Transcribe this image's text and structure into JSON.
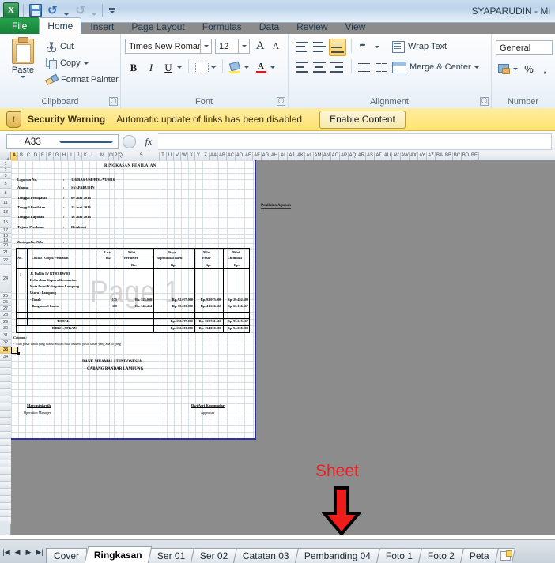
{
  "window": {
    "title": "SYAPARUDIN  -  Mi",
    "logo_text": "X"
  },
  "quick_access": {
    "save_tip": "Save",
    "undo_tip": "Undo",
    "redo_tip": "Redo",
    "customize_tip": "Customize Quick Access Toolbar"
  },
  "ribbon": {
    "tabs": [
      {
        "label": "File",
        "state": "file"
      },
      {
        "label": "Home",
        "state": "active"
      },
      {
        "label": "Insert",
        "state": ""
      },
      {
        "label": "Page Layout",
        "state": ""
      },
      {
        "label": "Formulas",
        "state": ""
      },
      {
        "label": "Data",
        "state": ""
      },
      {
        "label": "Review",
        "state": ""
      },
      {
        "label": "View",
        "state": ""
      }
    ],
    "clipboard": {
      "group_label": "Clipboard",
      "paste_label": "Paste",
      "cut_label": "Cut",
      "copy_label": "Copy",
      "format_painter_label": "Format Painter"
    },
    "font": {
      "group_label": "Font",
      "font_name": "Times New Roman",
      "font_size": "12",
      "bold_label": "B",
      "italic_label": "I",
      "underline_label": "U",
      "font_color_label": "A",
      "grow_label": "A",
      "shrink_label": "A"
    },
    "alignment": {
      "group_label": "Alignment",
      "wrap_text_label": "Wrap Text",
      "merge_center_label": "Merge & Center"
    },
    "number": {
      "group_label": "Number",
      "format": "General",
      "percent_label": "%",
      "comma_label": ","
    }
  },
  "security_bar": {
    "title": "Security Warning",
    "message": "Automatic update of links has been disabled",
    "button_label": "Enable Content"
  },
  "formula_bar": {
    "name_box": "A33",
    "fx_label": "fx",
    "formula": ""
  },
  "grid": {
    "columns": [
      "A",
      "B",
      "C",
      "D",
      "E",
      "F",
      "G",
      "H",
      "I",
      "J",
      "K",
      "L",
      "M",
      "O",
      "P",
      "Q",
      "S",
      "T",
      "U",
      "V",
      "W",
      "X",
      "Y",
      "Z",
      "AA",
      "AB",
      "AC",
      "AD",
      "AE",
      "AF",
      "AG",
      "AH",
      "AI",
      "AJ",
      "AK",
      "AL",
      "AM",
      "AN",
      "AO",
      "AP",
      "AQ",
      "AR",
      "AS",
      "AT",
      "AU",
      "AV",
      "AW",
      "AX",
      "AY",
      "AZ",
      "BA",
      "BB",
      "BC",
      "BD",
      "BE"
    ],
    "selected_column": "A",
    "rows": [
      "1",
      "2",
      "3",
      "5",
      "8",
      "11",
      "13",
      "15",
      "17",
      "18",
      "19",
      "20",
      "21",
      "22",
      "24",
      "25",
      "26",
      "27",
      "28",
      "29",
      "30",
      "31",
      "32",
      "33",
      "34"
    ],
    "selected_row": "33",
    "watermark": "Page 1"
  },
  "document": {
    "title": "RINGKASAN PENILAIAN",
    "side_note": "Penilaian Agunan",
    "fields": [
      {
        "label": "Laporan No.",
        "sep": ":",
        "value": "126/RAS-USP/BDL/VI/2016"
      },
      {
        "label": "Alamat",
        "sep": ":",
        "value": "SYAPARUDIN"
      },
      {
        "label": "Tanggal Penugasan",
        "sep": ":",
        "value": "09 Juni 2016"
      },
      {
        "label": "Tanggal Penilaian",
        "sep": ":",
        "value": "15 Juni 2016"
      },
      {
        "label": "Tanggal Laporan",
        "sep": ":",
        "value": "16 Juni 2016"
      },
      {
        "label": "Tujuan Penilaian",
        "sep": ":",
        "value": "Retaksasi"
      }
    ],
    "summary_label": "Kesimpulan Nilai",
    "summary_sep": ":",
    "table": {
      "headers": [
        {
          "line1": "No.",
          "line2": "",
          "line3": ""
        },
        {
          "line1": "Lokasi / Objek Penilaian",
          "line2": "",
          "line3": ""
        },
        {
          "line1": "Luas",
          "line2": "m2",
          "line3": ""
        },
        {
          "line1": "Nilai",
          "line2": "Permeter",
          "line3": "Rp."
        },
        {
          "line1": "Biaya",
          "line2": "Reproduksi Baru",
          "line3": "Rp."
        },
        {
          "line1": "Nilai",
          "line2": "Pasar",
          "line3": "Rp."
        },
        {
          "line1": "Nilai",
          "line2": "Likuidasi",
          "line3": "Rp."
        }
      ],
      "object_no": "1",
      "object_lines": [
        "Jl. Dahlia IV  RT  03  RW  03",
        "Kelurahan    Gapura    Kecamatan",
        "Kota  Bumi  Kabupaten  Lampung",
        "Utara - Lampung"
      ],
      "rows": [
        {
          "name": "- Tanah",
          "luas": "175",
          "permeter": "Rp.  525.000",
          "biaya": "Rp.  92.075.000",
          "pasar": "Rp.  92.075.000",
          "likuidasi": "Rp.  29.452.500"
        },
        {
          "name": "- Bangunan 1 Lantai",
          "luas": "110",
          "permeter": "Rp.  545.454",
          "biaya": "Rp.  60.000.000",
          "pasar": "Rp.  41.666.667",
          "likuidasi": "Rp.  66.166.667"
        }
      ],
      "total_label": "TOTAL",
      "total": {
        "biaya": "Rp.  152.075.000",
        "pasar": "Rp.  133.741.667",
        "likuidasi": "Rp.  95.619.167"
      },
      "rounded_label": "DIBULATKAN",
      "rounded": {
        "biaya": "Rp.  152.000.000",
        "pasar": "Rp.  134.000.000",
        "likuidasi": "Rp.  94.000.000"
      }
    },
    "notes_label": "Catatan :",
    "notes_text": "- Nilai pasar tanah yang diakui adalah nilai assumsi pasar tanah yang ada di gang",
    "bank_line1": "BANK MUAMALAT INDONESIA",
    "bank_line2": "CABANG BANDAR LAMPUNG",
    "signature_left": {
      "name": "Marcusinisreth",
      "title": "Operation Manager"
    },
    "signature_right": {
      "name": "Dwi Asri Kusumadar",
      "title": "Appraiser"
    }
  },
  "annotation": {
    "label": "Sheet",
    "arrow_color": "#ef1c1c",
    "label_color": "#f01d1d"
  },
  "sheet_tabs": {
    "nav_first": "|◀",
    "nav_prev": "◀",
    "nav_next": "▶",
    "nav_last": "▶|",
    "tabs": [
      {
        "label": "Cover",
        "active": false
      },
      {
        "label": "Ringkasan",
        "active": true
      },
      {
        "label": "Ser 01",
        "active": false
      },
      {
        "label": "Ser 02",
        "active": false
      },
      {
        "label": "Catatan 03",
        "active": false
      },
      {
        "label": "Pembanding 04",
        "active": false
      },
      {
        "label": "Foto 1",
        "active": false
      },
      {
        "label": "Foto 2",
        "active": false
      },
      {
        "label": "Peta",
        "active": false
      }
    ],
    "new_sheet_tip": "Insert Worksheet"
  }
}
